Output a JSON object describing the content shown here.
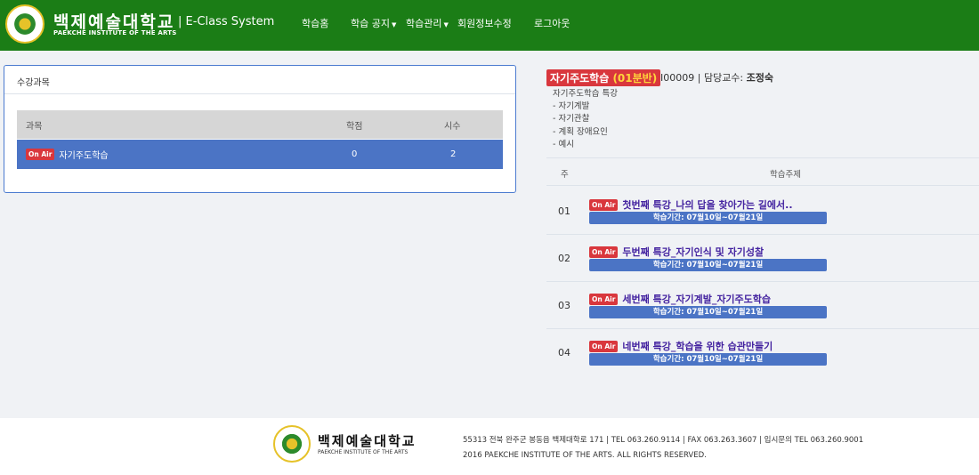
{
  "header": {
    "brand_kr": "백제예술대학교",
    "brand_en": "PAEKCHE INSTITUTE OF THE ARTS",
    "system": "| E-Class System",
    "nav": [
      {
        "label": "학습홈",
        "dropdown": false
      },
      {
        "label": "학습 공지",
        "dropdown": true
      },
      {
        "label": "학습관리",
        "dropdown": true
      },
      {
        "label": "회원정보수정",
        "dropdown": false
      },
      {
        "label": "로그아웃",
        "dropdown": false
      }
    ]
  },
  "courses": {
    "title": "수강과목",
    "columns": [
      "과목",
      "학점",
      "시수"
    ],
    "rows": [
      {
        "badge": "On Air",
        "name": "자기주도학습",
        "credits": "0",
        "hours": "2"
      }
    ]
  },
  "detail": {
    "course_name": "자기주도학습",
    "section": "(01분반)",
    "code": "I00009",
    "professor_label": "| 담당교수:",
    "professor": "조정숙",
    "description": [
      "자기주도학습 특강",
      "- 자기계발",
      "- 자기관찰",
      "- 계획 장애요인",
      "- 예시"
    ],
    "columns": [
      "주",
      "학습주제"
    ],
    "weeks": [
      {
        "num": "01",
        "badge": "On Air",
        "topic": "첫번째 특강_나의 답을 찾아가는 길에서..",
        "period": "학습기간: 07월10일~07월21일"
      },
      {
        "num": "02",
        "badge": "On Air",
        "topic": "두번째 특강_자기인식 및 자기성찰",
        "period": "학습기간: 07월10일~07월21일"
      },
      {
        "num": "03",
        "badge": "On Air",
        "topic": "세번째 특강_자기계발_자기주도학습",
        "period": "학습기간: 07월10일~07월21일"
      },
      {
        "num": "04",
        "badge": "On Air",
        "topic": "네번째 특강_학습을 위한 습관만들기",
        "period": "학습기간: 07월10일~07월21일"
      }
    ]
  },
  "footer": {
    "brand_kr": "백제예술대학교",
    "brand_en": "PAEKCHE INSTITUTE OF THE ARTS",
    "address": "55313 전북 완주군 봉동읍 백제대학로 171 | TEL 063.260.9114 | FAX 063.263.3607 | 입시문의 TEL 063.260.9001",
    "copyright": "2016 PAEKCHE INSTITUTE OF THE ARTS. ALL RIGHTS RESERVED."
  },
  "colors": {
    "header_green": "#1b7d16",
    "accent_blue": "#4b74c5",
    "onair_red": "#d9373d",
    "topic_purple": "#4423a0"
  }
}
